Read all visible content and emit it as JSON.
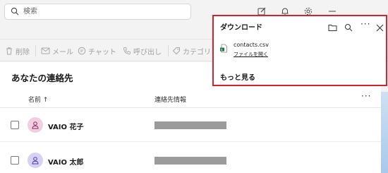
{
  "titlebar": {
    "search_placeholder": "検索"
  },
  "toolbar": {
    "items": [
      {
        "label": "削除",
        "icon": "trash-icon"
      },
      {
        "label": "メール",
        "icon": "mail-icon"
      },
      {
        "label": "チャット",
        "icon": "chat-icon"
      },
      {
        "label": "呼び出し",
        "icon": "phone-icon"
      },
      {
        "label": "カテゴリ",
        "icon": "tag-icon"
      }
    ]
  },
  "contacts": {
    "section_title": "あなたの連絡先",
    "columns": {
      "name": "名前 ↑",
      "contact_info": "連絡先情報",
      "more": "···"
    },
    "rows": [
      {
        "name": "VAIO 花子",
        "avatar_color": "#f1cfe1"
      },
      {
        "name": "VAIO 太郎",
        "avatar_color": "#d7d2f5"
      }
    ]
  },
  "download_panel": {
    "title": "ダウンロード",
    "more_actions": "···",
    "file": {
      "name": "contacts.csv",
      "action": "ファイルを開く"
    },
    "show_more": "もっと見る",
    "highlight_color": "#d6242d"
  }
}
